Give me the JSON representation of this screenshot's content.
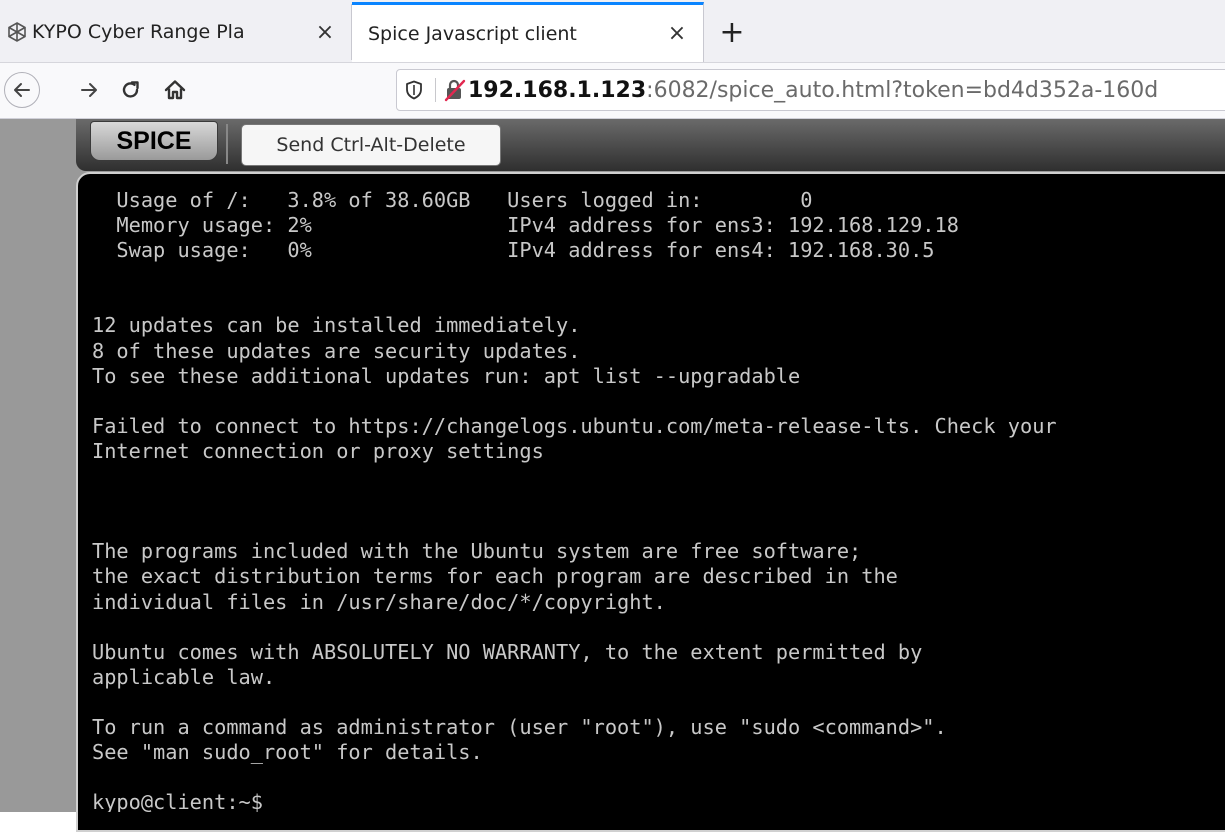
{
  "browser": {
    "tabs": [
      {
        "title": "KYPO Cyber Range Pla",
        "favicon": "kypo-logo-icon",
        "active": false,
        "close": "×"
      },
      {
        "title": "Spice Javascript client",
        "favicon": "",
        "active": true,
        "close": "×"
      }
    ],
    "new_tab": "+",
    "nav": {
      "back": "←",
      "forward": "→",
      "reload": "C",
      "home": "home-icon"
    },
    "url": {
      "host": "192.168.1.123",
      "rest": ":6082/spice_auto.html?token=bd4d352a-160d"
    }
  },
  "spice": {
    "logo": "SPICE",
    "send_cad_label": "Send Ctrl-Alt-Delete"
  },
  "terminal": {
    "lines": [
      "  Usage of /:   3.8% of 38.60GB   Users logged in:        0",
      "  Memory usage: 2%                IPv4 address for ens3: 192.168.129.18",
      "  Swap usage:   0%                IPv4 address for ens4: 192.168.30.5",
      "",
      "",
      "12 updates can be installed immediately.",
      "8 of these updates are security updates.",
      "To see these additional updates run: apt list --upgradable",
      "",
      "Failed to connect to https://changelogs.ubuntu.com/meta-release-lts. Check your",
      "Internet connection or proxy settings",
      "",
      "",
      "",
      "The programs included with the Ubuntu system are free software;",
      "the exact distribution terms for each program are described in the",
      "individual files in /usr/share/doc/*/copyright.",
      "",
      "Ubuntu comes with ABSOLUTELY NO WARRANTY, to the extent permitted by",
      "applicable law.",
      "",
      "To run a command as administrator (user \"root\"), use \"sudo <command>\".",
      "See \"man sudo_root\" for details.",
      "",
      "kypo@client:~$ "
    ]
  }
}
